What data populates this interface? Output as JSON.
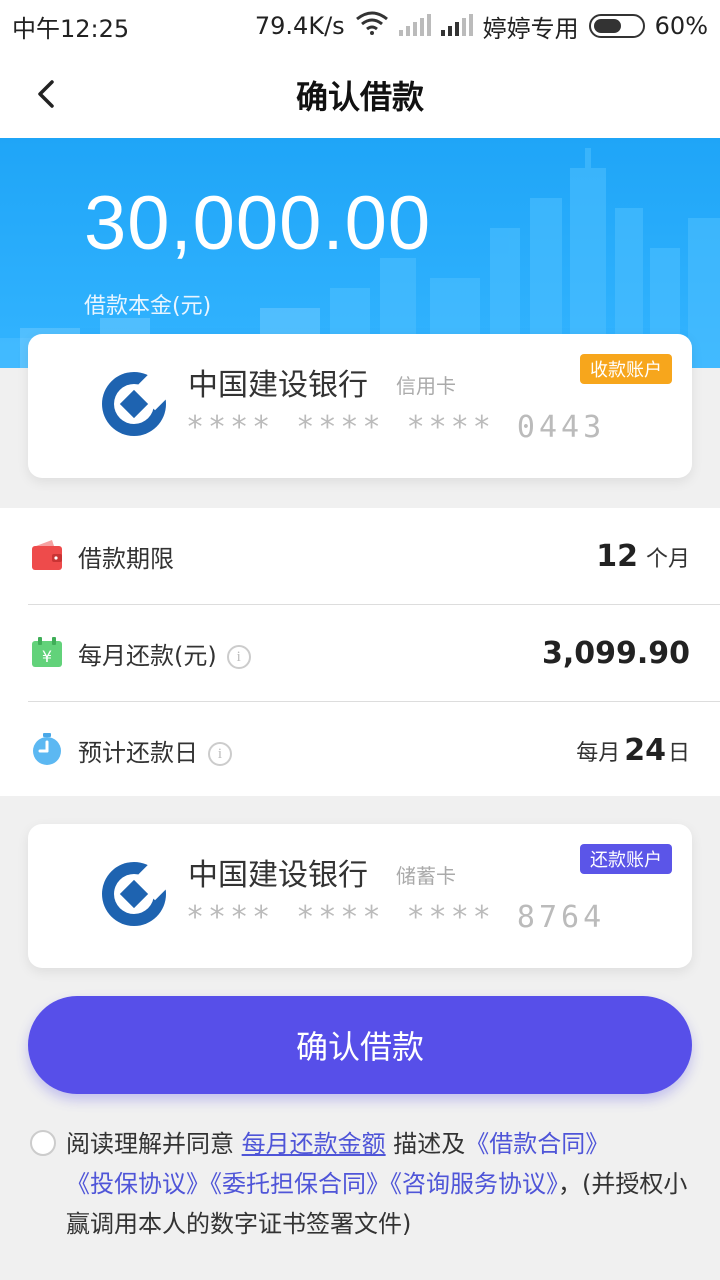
{
  "status_bar": {
    "time": "中午12:25",
    "net_speed": "79.4K/s",
    "carrier": "婷婷专用",
    "battery": "60%",
    "battery_level": 0.6
  },
  "nav": {
    "title": "确认借款",
    "back_icon": "chevron-left-icon"
  },
  "loan": {
    "amount": "30,000.00",
    "amount_label": "借款本金(元)"
  },
  "receive_card": {
    "bank_name": "中国建设银行",
    "card_type": "信用卡",
    "card_number": "**** **** **** 0443",
    "tag": "收款账户",
    "tag_color": "#f7a61c"
  },
  "details": {
    "term": {
      "label": "借款期限",
      "value": "12",
      "unit": "个月",
      "icon": "wallet-icon"
    },
    "monthly": {
      "label": "每月还款(元)",
      "value": "3,099.90",
      "icon": "calendar-yen-icon"
    },
    "due_day": {
      "label": "预计还款日",
      "prefix": "每月",
      "value": "24",
      "suffix": "日",
      "icon": "stopwatch-icon"
    }
  },
  "repay_card": {
    "bank_name": "中国建设银行",
    "card_type": "储蓄卡",
    "card_number": "**** **** **** 8764",
    "tag": "还款账户",
    "tag_color": "#5b55e8"
  },
  "confirm_button": "确认借款",
  "agreement": {
    "prefix": "阅读理解并同意",
    "link_monthly": "每月还款金额",
    "middle": "描述及",
    "link_loan": "《借款合同》",
    "link_insurance": "《投保协议》",
    "link_guarantee": "《委托担保合同》",
    "link_consult": "《咨询服务协议》",
    "suffix": "，(并授权小赢调用本人的数字证书签署文件)"
  },
  "colors": {
    "primary": "#574fe9",
    "hero_blue": "#1fa5f7",
    "link": "#4f55d8"
  }
}
